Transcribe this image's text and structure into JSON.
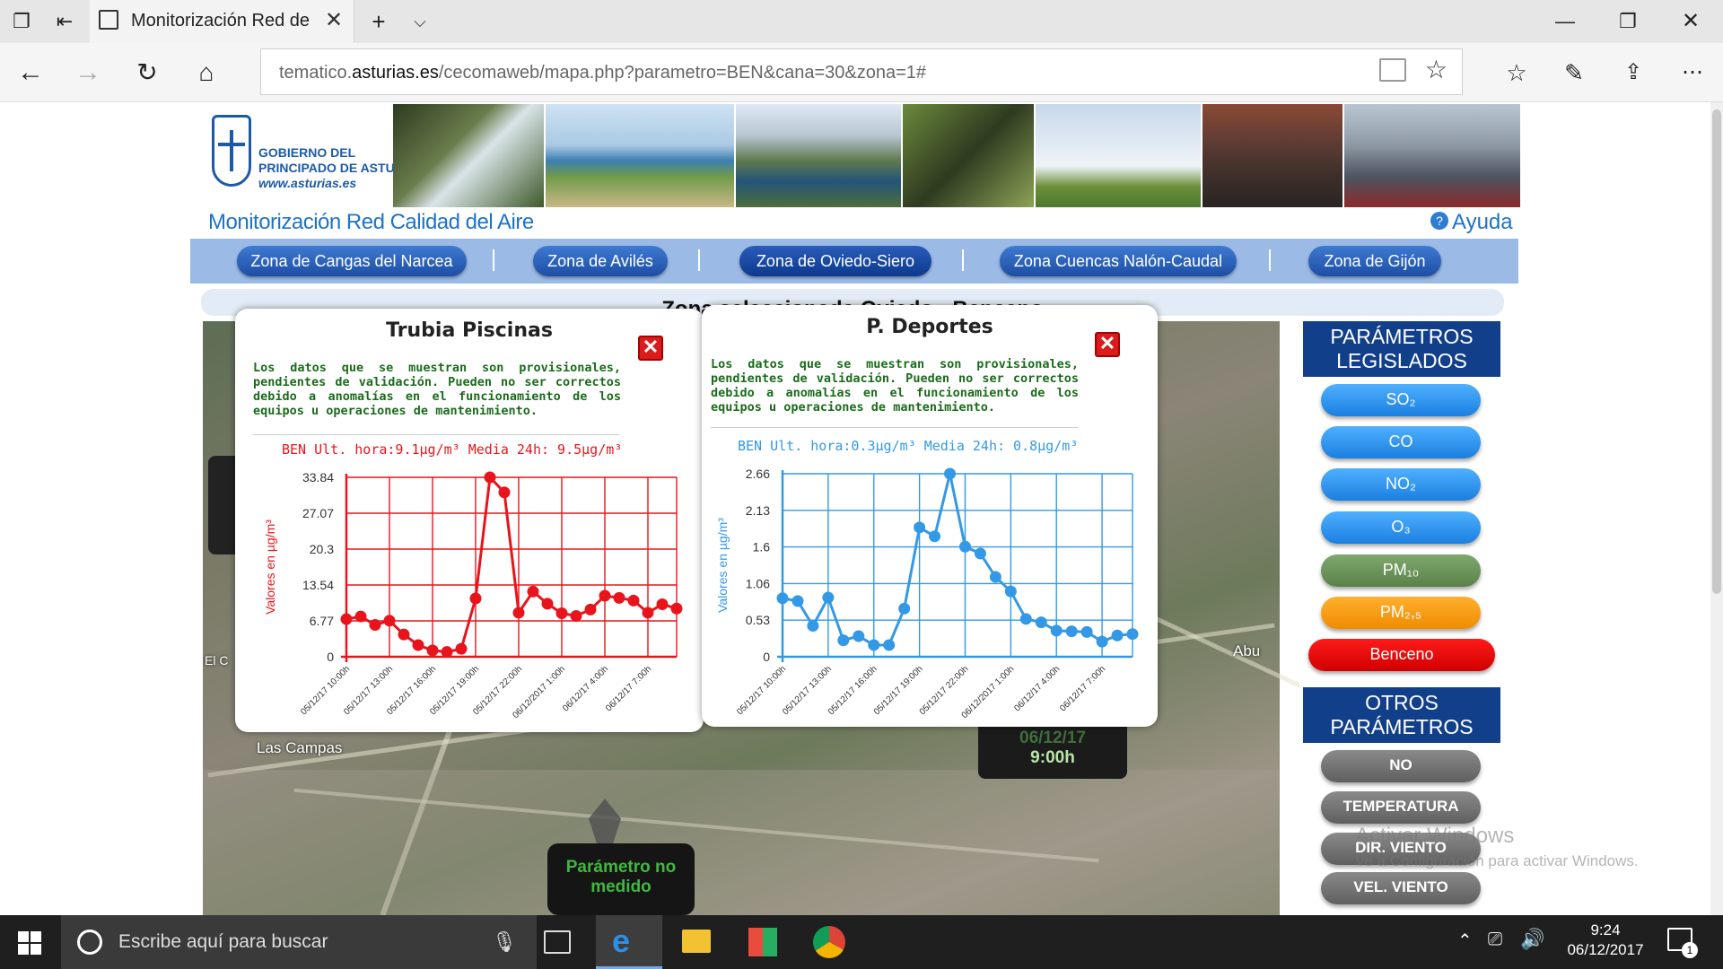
{
  "browser": {
    "tab_title": "Monitorización Red de",
    "url_prefix": "tematico.",
    "url_domain": "asturias.es",
    "url_path": "/cecomaweb/mapa.php?parametro=BEN&cana=30&zona=1#"
  },
  "header": {
    "logo_line1": "GOBIERNO DEL",
    "logo_line2": "PRINCIPADO DE ASTURIAS",
    "logo_line3": "www.asturias.es",
    "site_title": "Monitorización Red Calidad del Aire",
    "help": "Ayuda"
  },
  "nav": {
    "zones": [
      "Zona de Cangas del Narcea",
      "Zona de Avilés",
      "Zona de Oviedo-Siero",
      "Zona Cuencas Nalón-Caudal",
      "Zona de Gijón"
    ],
    "active_index": 2
  },
  "zone_selected": "Zona seleccionada Oviedo - Benceno",
  "map": {
    "label_campas": "Las Campas",
    "label_abu": "Abu",
    "label_ec": "El C",
    "date_box_line1": "06/12/17",
    "date_box_line2": "9:00h",
    "not_measured": "Parámetro no medido"
  },
  "popups": [
    {
      "title": "Trubia Piscinas",
      "note": "Los datos que se muestran son provisionales, pendientes de validación. Pueden no ser correctos debido a anomalías en el funcionamiento de los equipos u operaciones de mantenimiento.",
      "header": "BEN Ult. hora:9.1µg/m³ Media 24h: 9.5µg/m³",
      "ylabel": "Valores en µg/m³"
    },
    {
      "title": "P. Deportes",
      "note": "Los datos que se muestran son provisionales, pendientes de validación. Pueden no ser correctos debido a anomalías en el funcionamiento de los equipos u operaciones de mantenimiento.",
      "header": "BEN Ult. hora:0.3µg/m³ Media 24h: 0.8µg/m³",
      "ylabel": "Valores en µg/m³"
    }
  ],
  "chart_data": [
    {
      "type": "line",
      "color": "#e8141c",
      "yticks": [
        "0",
        "6.77",
        "13.54",
        "20.3",
        "27.07",
        "33.84"
      ],
      "ylim": [
        0,
        33.84
      ],
      "xticks": [
        "05/12/17 10:00h",
        "05/12/17 13:00h",
        "05/12/17 16:00h",
        "05/12/17 19:00h",
        "05/12/17 22:00h",
        "06/12/2017 1:00h",
        "06/12/17 4:00h",
        "06/12/17 7:00h"
      ],
      "grid": true,
      "values": [
        7.1,
        7.6,
        6.0,
        6.8,
        4.2,
        2.2,
        1.2,
        0.9,
        1.5,
        11.0,
        33.84,
        31.0,
        8.3,
        12.3,
        10.0,
        8.2,
        7.7,
        8.9,
        11.5,
        11.1,
        10.6,
        8.3,
        9.9,
        9.1
      ]
    },
    {
      "type": "line",
      "color": "#3399e6",
      "yticks": [
        "0",
        "0.53",
        "1.06",
        "1.6",
        "2.13",
        "2.66"
      ],
      "ylim": [
        0,
        2.66
      ],
      "xticks": [
        "05/12/17 10:00h",
        "05/12/17 13:00h",
        "05/12/17 16:00h",
        "05/12/17 19:00h",
        "05/12/17 22:00h",
        "06/12/2017 1:00h",
        "06/12/17 4:00h",
        "06/12/17 7:00h"
      ],
      "grid": true,
      "values": [
        0.85,
        0.81,
        0.45,
        0.86,
        0.24,
        0.3,
        0.17,
        0.17,
        0.7,
        1.88,
        1.75,
        2.66,
        1.6,
        1.5,
        1.16,
        0.95,
        0.55,
        0.5,
        0.38,
        0.37,
        0.36,
        0.22,
        0.31,
        0.33
      ]
    }
  ],
  "right_panel": {
    "legislated_title": "PARÁMETROS LEGISLADOS",
    "legislated": [
      "SO₂",
      "CO",
      "NO₂",
      "O₃",
      "PM₁₀",
      "PM₂,₅",
      "Benceno"
    ],
    "other_title": "OTROS PARÁMETROS",
    "other": [
      "NO",
      "TEMPERATURA",
      "DIR. VIENTO",
      "VEL. VIENTO"
    ]
  },
  "watermark": {
    "line1": "Activar Windows",
    "line2": "Ve a Configuración para activar Windows."
  },
  "taskbar": {
    "search_placeholder": "Escribe aquí para buscar",
    "time": "9:24",
    "date": "06/12/2017",
    "notif_count": "1"
  }
}
